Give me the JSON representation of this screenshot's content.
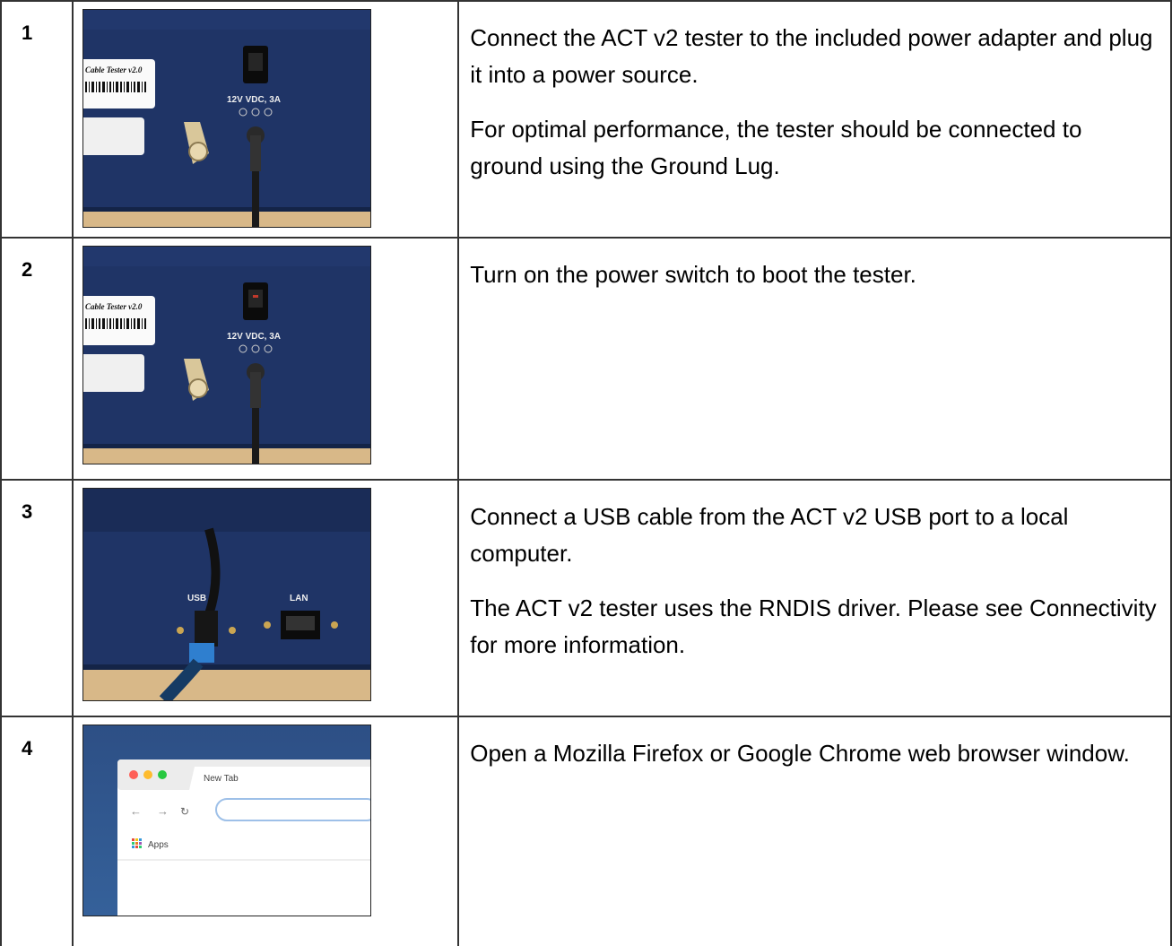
{
  "steps": [
    {
      "number": "1",
      "photo": "power-adapter-photo",
      "paragraphs": [
        "Connect the ACT v2 tester to the included power adapter and plug it into a power source.",
        "For optimal performance, the tester should be connected to ground using the Ground Lug."
      ],
      "photo_text": {
        "label": "Cable Tester v2.0",
        "power": "12V VDC, 3A"
      }
    },
    {
      "number": "2",
      "photo": "power-switch-photo",
      "paragraphs": [
        "Turn on the power switch to boot the tester."
      ],
      "photo_text": {
        "label": "Cable Tester v2.0",
        "power": "12V VDC, 3A"
      }
    },
    {
      "number": "3",
      "photo": "usb-port-photo",
      "paragraphs": [
        "Connect a USB cable from the ACT v2 USB port to a local computer.",
        "The ACT v2 tester uses the RNDIS driver. Please see Connectivity for more information."
      ],
      "photo_text": {
        "usb": "USB",
        "lan": "LAN"
      }
    },
    {
      "number": "4",
      "photo": "browser-window-screenshot",
      "paragraphs": [
        "Open a Mozilla Firefox or Google Chrome web browser window."
      ],
      "photo_text": {
        "tab": "New Tab",
        "apps": "Apps"
      }
    }
  ],
  "colors": {
    "tester_blue": "#1f3466",
    "desk_wood": "#d8b888",
    "border": "#333333"
  }
}
